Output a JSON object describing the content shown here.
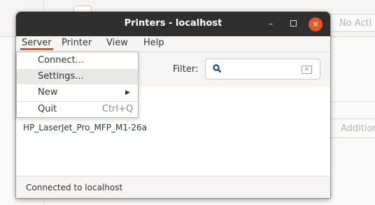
{
  "background": {
    "no_action_label": "No Acti",
    "additional_label": "Additional"
  },
  "window": {
    "title": "Printers - localhost",
    "minimize_glyph": "–",
    "close_glyph": "✕"
  },
  "menubar": {
    "items": [
      "Server",
      "Printer",
      "View",
      "Help"
    ]
  },
  "server_menu": {
    "items": [
      {
        "label": "Connect..."
      },
      {
        "label": "Settings..."
      },
      {
        "label": "New",
        "submenu_glyph": "▶"
      },
      {
        "label": "Quit",
        "shortcut": "Ctrl+Q"
      }
    ]
  },
  "toolbar": {
    "filter_label": "Filter:",
    "filter_value": "",
    "clear_glyph": "✕"
  },
  "printers": [
    {
      "name": "HP_LaserJet_Pro_MFP_M1-26a"
    }
  ],
  "status": {
    "text": "Connected to localhost"
  },
  "colors": {
    "accent": "#e95420",
    "titlebar": "#2f2f2f"
  },
  "icons": [
    "search-icon",
    "clear-icon",
    "close-icon",
    "minimize-icon",
    "maximize-icon",
    "printer-icon",
    "submenu-arrow-icon"
  ]
}
